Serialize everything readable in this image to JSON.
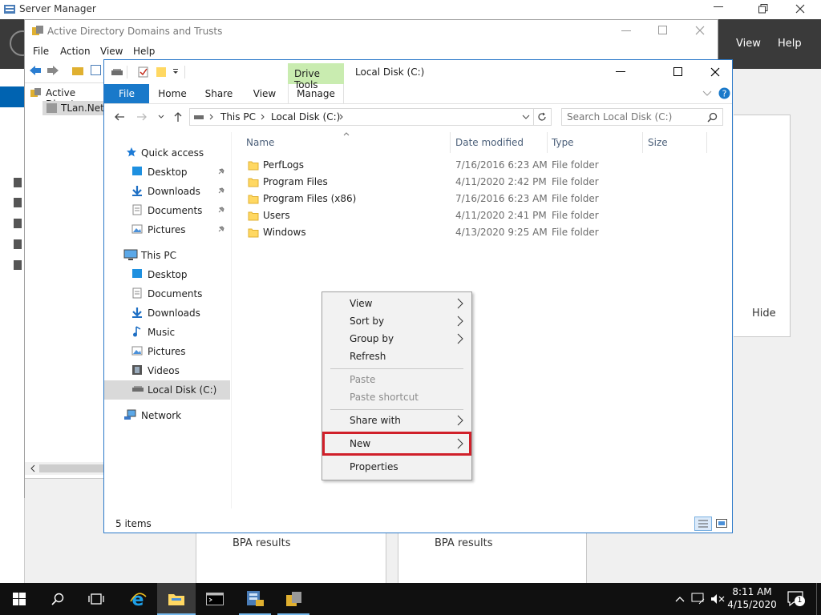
{
  "server_manager": {
    "title": "Server Manager",
    "menu_view": "View",
    "menu_help": "Help",
    "hide_label": "Hide",
    "bpa_left": "BPA results",
    "bpa_right": "BPA results"
  },
  "ad": {
    "title": "Active Directory Domains and Trusts",
    "menu": [
      "File",
      "Action",
      "View",
      "Help"
    ],
    "tree_root": "Active Directo",
    "tree_child": "TLan.Net"
  },
  "explorer": {
    "drive_tools": "Drive Tools",
    "title": "Local Disk (C:)",
    "tabs": {
      "file": "File",
      "home": "Home",
      "share": "Share",
      "view": "View",
      "manage": "Manage"
    },
    "breadcrumb": [
      "This PC",
      "Local Disk (C:)"
    ],
    "search_placeholder": "Search Local Disk (C:)",
    "nav": {
      "quick_access": "Quick access",
      "qa_items": [
        "Desktop",
        "Downloads",
        "Documents",
        "Pictures"
      ],
      "this_pc": "This PC",
      "pc_items": [
        "Desktop",
        "Documents",
        "Downloads",
        "Music",
        "Pictures",
        "Videos",
        "Local Disk (C:)"
      ],
      "network": "Network"
    },
    "columns": {
      "name": "Name",
      "date": "Date modified",
      "type": "Type",
      "size": "Size"
    },
    "files": [
      {
        "name": "PerfLogs",
        "date": "7/16/2016 6:23 AM",
        "type": "File folder"
      },
      {
        "name": "Program Files",
        "date": "4/11/2020 2:42 PM",
        "type": "File folder"
      },
      {
        "name": "Program Files (x86)",
        "date": "7/16/2016 6:23 AM",
        "type": "File folder"
      },
      {
        "name": "Users",
        "date": "4/11/2020 2:41 PM",
        "type": "File folder"
      },
      {
        "name": "Windows",
        "date": "4/13/2020 9:25 AM",
        "type": "File folder"
      }
    ],
    "status": "5 items"
  },
  "context_menu": {
    "view": "View",
    "sort_by": "Sort by",
    "group_by": "Group by",
    "refresh": "Refresh",
    "paste": "Paste",
    "paste_shortcut": "Paste shortcut",
    "share_with": "Share with",
    "new": "New",
    "properties": "Properties",
    "highlight_color": "#d0202a"
  },
  "taskbar": {
    "time": "8:11 AM",
    "date": "4/15/2020",
    "notification_count": "1"
  },
  "colors": {
    "accent": "#0063b1",
    "folder": "#ffd862",
    "drive_tools_bg": "#c9ecb0"
  }
}
